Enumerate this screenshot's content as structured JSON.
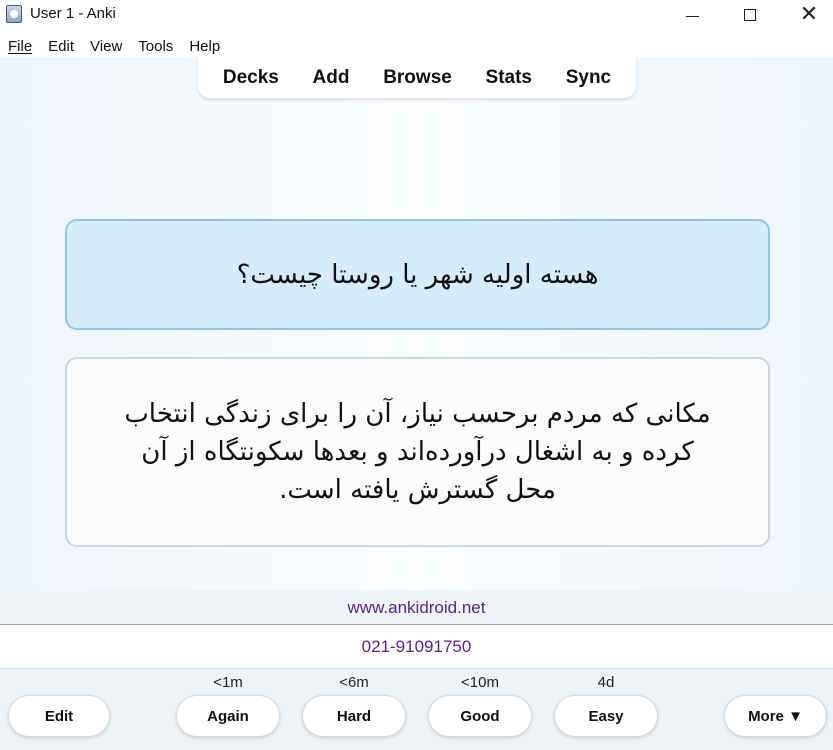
{
  "window": {
    "title": "User 1 - Anki",
    "minimize": "",
    "maximize": "",
    "close": "✕"
  },
  "menu": {
    "items": [
      "File",
      "Edit",
      "View",
      "Tools",
      "Help"
    ]
  },
  "toolbar": {
    "items": [
      "Decks",
      "Add",
      "Browse",
      "Stats",
      "Sync"
    ]
  },
  "card": {
    "question": "هسته اولیه شهر یا روستا چیست؟",
    "answer": "مکانی که مردم برحسب نیاز، آن را برای زندگی انتخاب کرده و به اشغال درآورده‌اند و بعدها سکونتگاه از آن محل گسترش یافته است."
  },
  "footer": {
    "website": "www.ankidroid.net",
    "phone": "021-91091750"
  },
  "answer_buttons": {
    "edit": "Edit",
    "again": {
      "label": "Again",
      "interval": "<1m"
    },
    "hard": {
      "label": "Hard",
      "interval": "<6m"
    },
    "good": {
      "label": "Good",
      "interval": "<10m"
    },
    "easy": {
      "label": "Easy",
      "interval": "4d"
    },
    "more": "More ▼"
  },
  "colors": {
    "question_bg": "#d6ecfa",
    "question_border": "#91c6ea",
    "footer_text": "#5a1f8c"
  }
}
